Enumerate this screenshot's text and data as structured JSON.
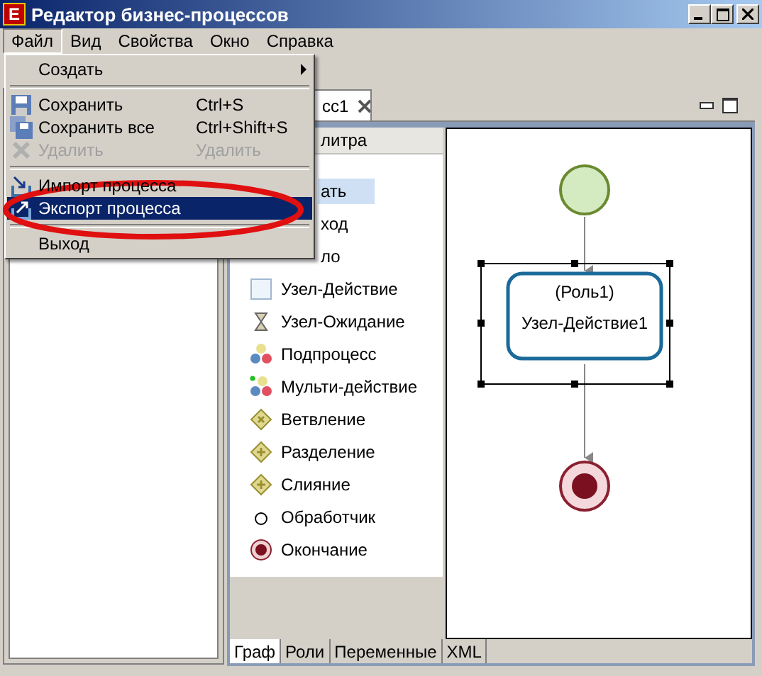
{
  "window": {
    "icon_letter": "E",
    "title": "Редактор бизнес-процессов"
  },
  "menu_bar": [
    {
      "label": "Файл",
      "selected": true
    },
    {
      "label": "Вид",
      "selected": false
    },
    {
      "label": "Свойства",
      "selected": false
    },
    {
      "label": "Окно",
      "selected": false
    },
    {
      "label": "Справка",
      "selected": false
    }
  ],
  "file_menu": [
    {
      "kind": "submenu",
      "label": "Создать",
      "disabled": false,
      "selected": false
    },
    {
      "kind": "separator"
    },
    {
      "kind": "save",
      "label": "Сохранить",
      "shortcut": "Ctrl+S",
      "disabled": false,
      "selected": false
    },
    {
      "kind": "saveall",
      "label": "Сохранить все",
      "shortcut": "Ctrl+Shift+S",
      "disabled": false,
      "selected": false
    },
    {
      "kind": "delete",
      "label": "Удалить",
      "shortcut": "Удалить",
      "disabled": true,
      "selected": false
    },
    {
      "kind": "separator"
    },
    {
      "kind": "import",
      "label": "Импорт процесса",
      "disabled": false,
      "selected": false
    },
    {
      "kind": "export",
      "label": "Экспорт процесса",
      "disabled": false,
      "selected": true
    },
    {
      "kind": "separator"
    },
    {
      "kind": "plain",
      "label": "Выход",
      "disabled": false,
      "selected": false
    }
  ],
  "editor_tab": {
    "label": "сс1"
  },
  "palette": {
    "header": "литра",
    "items": [
      {
        "kind": "covered",
        "label": "ать",
        "selected": true
      },
      {
        "kind": "covered",
        "label": "ход",
        "selected": false
      },
      {
        "kind": "covered",
        "label": "ло",
        "selected": false
      },
      {
        "kind": "action",
        "label": "Узел-Действие",
        "selected": false
      },
      {
        "kind": "wait",
        "label": "Узел-Ожидание",
        "selected": false
      },
      {
        "kind": "subprocess",
        "label": "Подпроцесс",
        "selected": false
      },
      {
        "kind": "multi",
        "label": "Мульти-действие",
        "selected": false
      },
      {
        "kind": "decision",
        "label": "Ветвление",
        "selected": false
      },
      {
        "kind": "fork",
        "label": "Разделение",
        "selected": false
      },
      {
        "kind": "join",
        "label": "Слияние",
        "selected": false
      },
      {
        "kind": "handler",
        "label": "Обработчик",
        "selected": false
      },
      {
        "kind": "end",
        "label": "Окончание",
        "selected": false
      }
    ]
  },
  "diagram": {
    "nodes": [
      {
        "kind": "start"
      },
      {
        "kind": "action",
        "role": "(Роль1)",
        "label": "Узел-Действие1",
        "selected": true
      },
      {
        "kind": "end"
      }
    ]
  },
  "bottom_tabs": [
    {
      "label": "Граф",
      "selected": true
    },
    {
      "label": "Роли",
      "selected": false
    },
    {
      "label": "Переменные",
      "selected": false
    },
    {
      "label": "XML",
      "selected": false
    }
  ]
}
